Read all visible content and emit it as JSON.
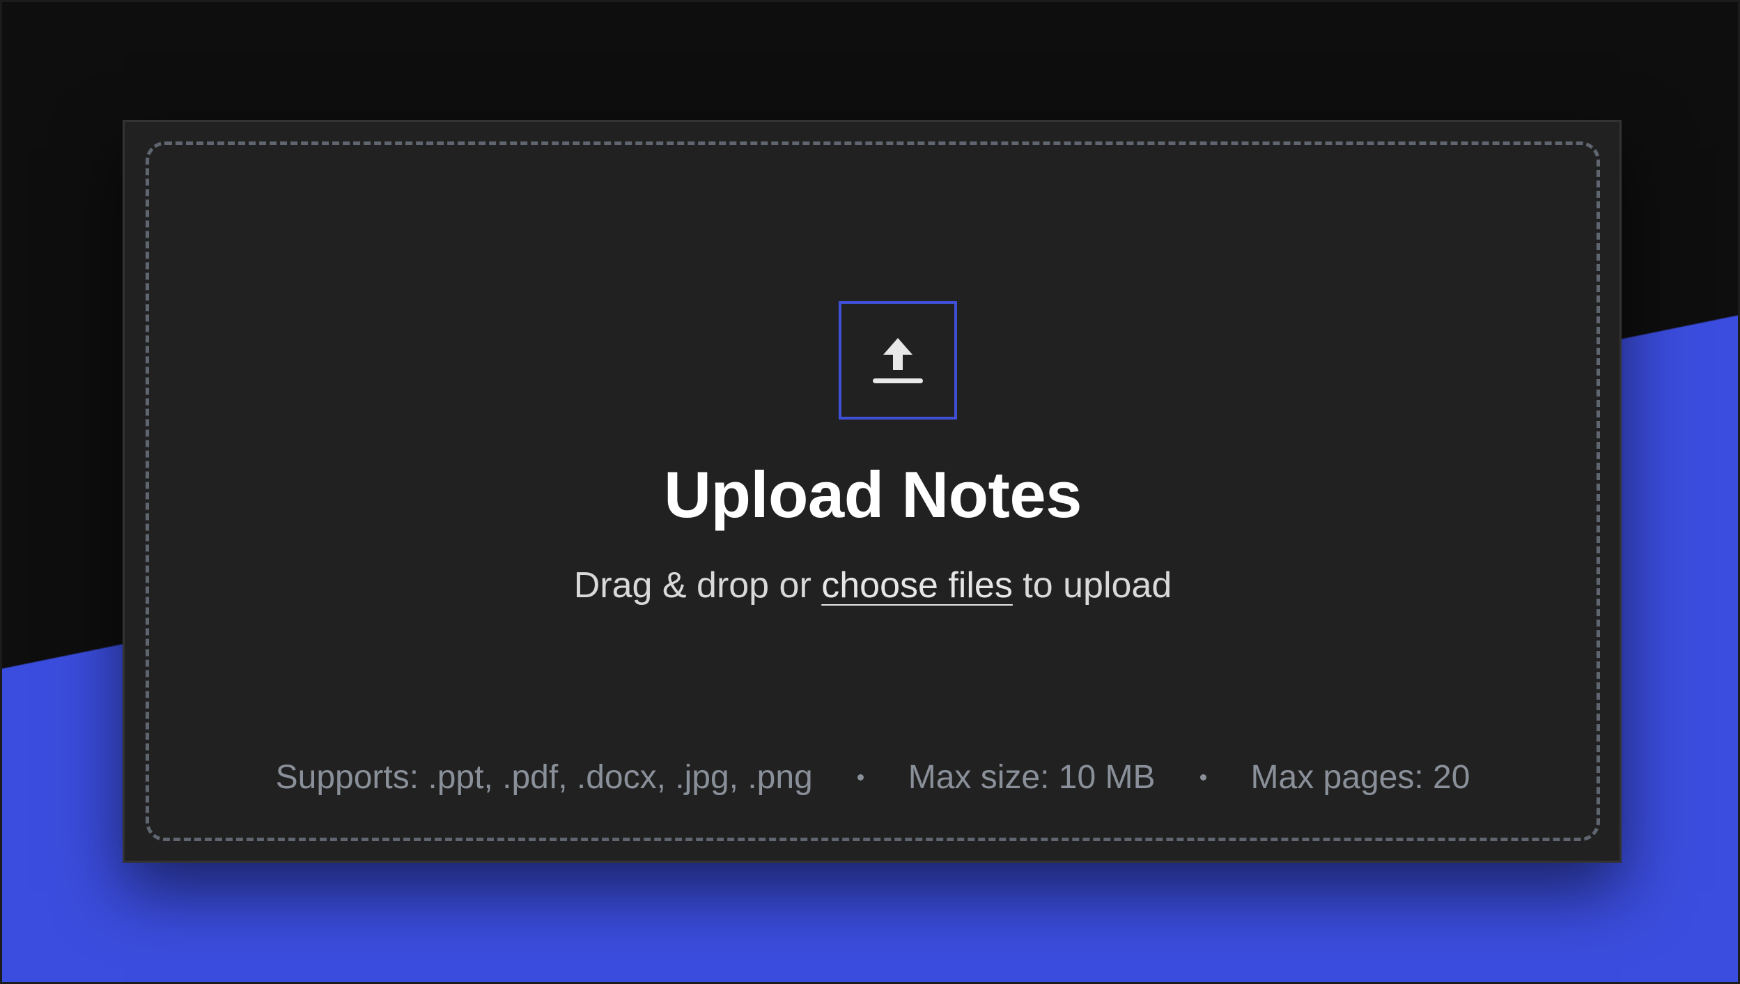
{
  "upload": {
    "icon": "upload-icon",
    "title": "Upload Notes",
    "prefix": "Drag & drop or",
    "link": "choose files",
    "suffix": "to upload",
    "supports": "Supports: .ppt, .pdf, .docx, .jpg, .png",
    "max_size": "Max size: 10 MB",
    "max_pages": "Max pages: 20"
  },
  "colors": {
    "accent": "#3b4dde",
    "background": "#0e0e0e",
    "card": "#212121"
  }
}
